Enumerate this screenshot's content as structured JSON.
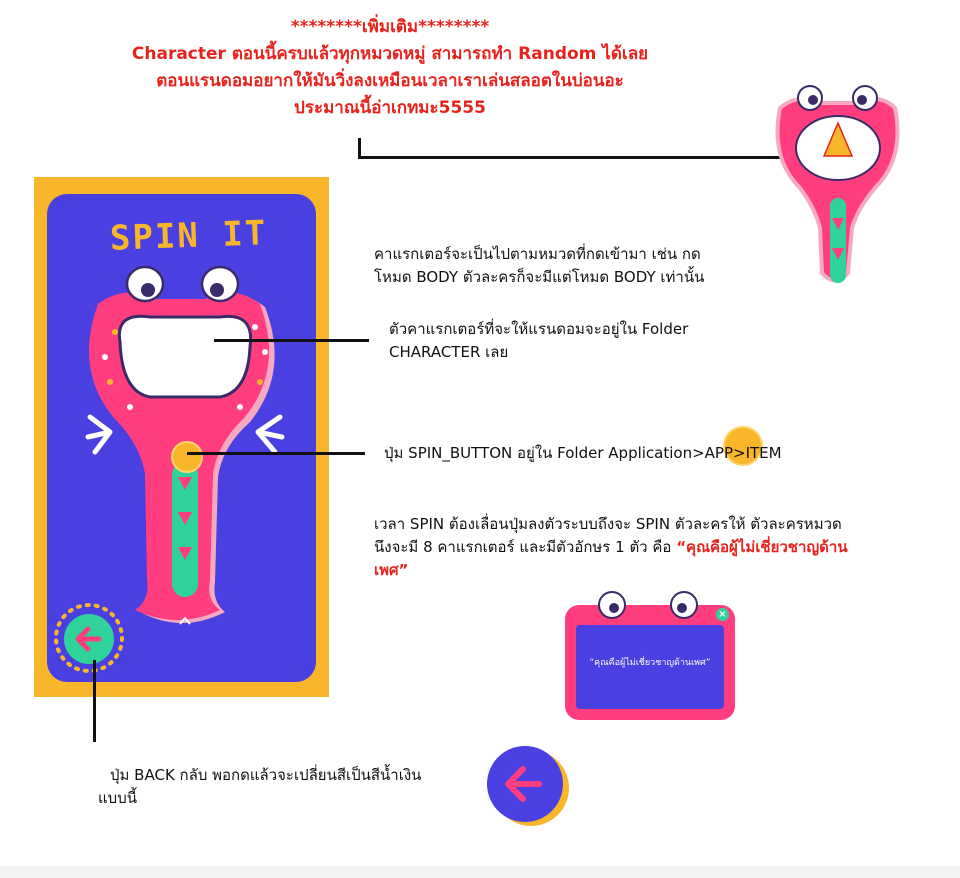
{
  "header": {
    "line1": "********เพิ่มเติม********",
    "line2": "Character ตอนนี้ครบแล้วทุกหมวดหมู่ สามารถทำ Random ได้เลย",
    "line3": "ตอนแรนดอมอยากให้มันวิ่งลงเหมือนเวลาเราเล่นสลอตในบ่อนอะ",
    "line4": "ประมาณนี้อ่าเกทมะ5555"
  },
  "screen": {
    "title": "SPIN IT"
  },
  "notes": {
    "category_line1": "คาแรกเตอร์จะเป็นไปตามหมวดที่กดเข้ามา เช่น กด",
    "category_line2": "โหมด BODY ตัวละครก็จะมีแต่โหมด BODY เท่านั้น",
    "folder_line1": "ตัวคาแรกเตอร์ที่จะให้แรนดอมจะอยู่ใน Folder",
    "folder_line2": "CHARACTER เลย",
    "spin_button": "ปุ่ม SPIN_BUTTON อยู่ใน Folder Application>APP>ITEM",
    "spin_line1": "เวลา SPIN ต้องเลื่อนปุ่มลงตัวระบบถึงจะ SPIN ตัวละครให้ ตัวละครหมวด",
    "spin_line2_a": "นึงจะมี 8 คาแรกเตอร์ และมีตัวอักษร 1 ตัว คือ ",
    "spin_line2_b": "“คุณคือผู้ไม่เชี่ยวชาญด้าน",
    "spin_line3": "เพศ”",
    "back_line1": "ปุ่ม BACK กลับ พอกดแล้วจะเปลี่ยนสีเป็นสีน้ำเงิน",
    "back_line2": "แบบนี้"
  },
  "popup": {
    "text": "“คุณคือผู้ไม่เชี่ยวชาญด้านเพศ”",
    "close": "×"
  },
  "colors": {
    "accent_red": "#e8231e",
    "frame_yellow": "#f9b62b",
    "panel_blue": "#4a3fe0",
    "monster_pink": "#ff3d7f",
    "button_green": "#2fd39a"
  }
}
